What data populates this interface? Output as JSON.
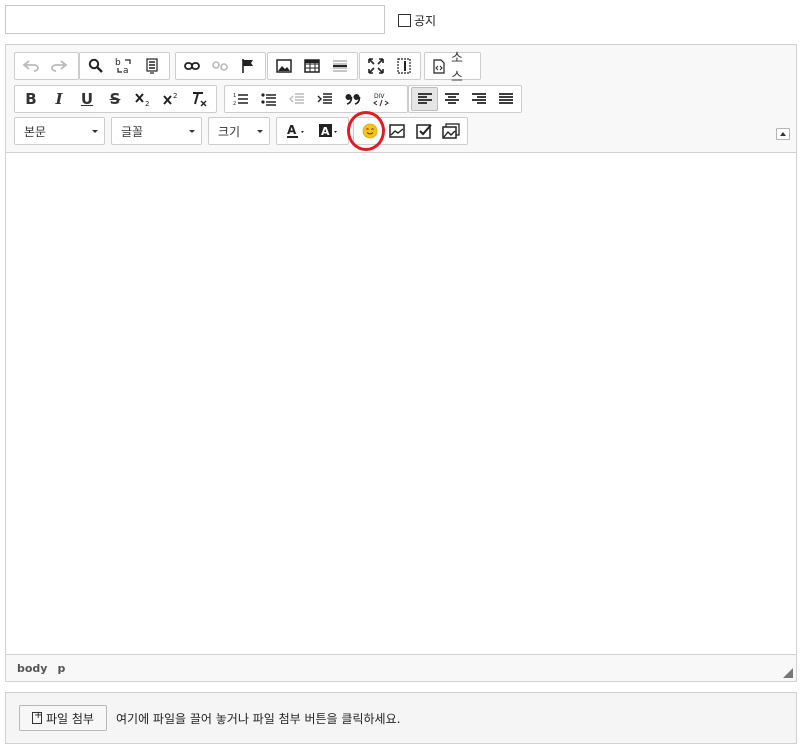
{
  "form": {
    "title_value": "",
    "notice_label": "공지"
  },
  "toolbar": {
    "row1": {
      "source_label": "소스"
    },
    "row3": {
      "format_combo": "본문",
      "font_combo": "글꼴",
      "size_combo": "크기"
    },
    "row2": {
      "bold": "B",
      "italic": "I",
      "underline": "U",
      "strike": "S"
    }
  },
  "statusbar": {
    "path": [
      "body",
      "p"
    ]
  },
  "attach": {
    "button_label": "파일 첨부",
    "hint": "여기에 파일을 끌어 놓거나 파일 첨부 버튼을 클릭하세요."
  },
  "colors": {
    "highlight_ring": "#e01b24",
    "toolbar_bg": "#f8f8f8",
    "border": "#d1d1d1"
  }
}
